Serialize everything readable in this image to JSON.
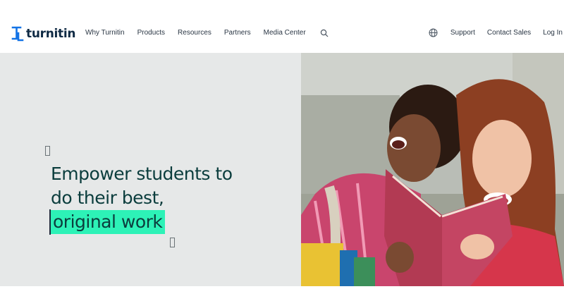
{
  "header": {
    "logo_text": "turnitin",
    "nav": [
      "Why Turnitin",
      "Products",
      "Resources",
      "Partners",
      "Media Center"
    ],
    "right_nav": {
      "support": "Support",
      "contact_sales": "Contact Sales",
      "login": "Log In"
    },
    "icons": {
      "search": "search-icon",
      "language": "globe-icon",
      "logo": "turnitin-logo-icon"
    }
  },
  "hero": {
    "headline_line1": "Empower students to",
    "headline_line2": "do their best,",
    "headline_highlight": "original work",
    "image": "two-students-laughing-with-book",
    "colors": {
      "background": "#e6e8e8",
      "headline": "#0b3d3d",
      "highlight": "#2df2b7",
      "brand_blue": "#1473e6"
    }
  }
}
